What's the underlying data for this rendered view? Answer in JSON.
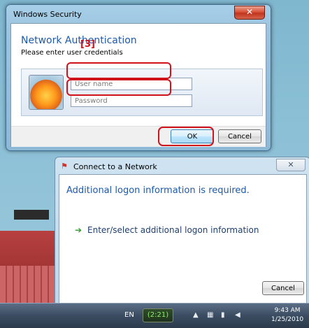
{
  "security_dialog": {
    "title": "Windows Security",
    "close": "✕",
    "heading": "Network Authentication",
    "subheading": "Please enter user credentials",
    "step_label": "[3]",
    "username_placeholder": "User name",
    "password_placeholder": "Password",
    "ok": "OK",
    "cancel": "Cancel"
  },
  "network_dialog": {
    "title": "Connect to a Network",
    "close": "✕",
    "heading": "Additional logon information is required.",
    "link": "Enter/select additional logon information",
    "link_icon": "➔",
    "cancel": "Cancel"
  },
  "taskbar": {
    "language": "EN",
    "battery": "(2:21)",
    "time": "9:43 AM",
    "date": "1/25/2010",
    "tray_icons": [
      "show-hidden-icon",
      "network-icon",
      "battery-icon",
      "volume-icon"
    ]
  },
  "colors": {
    "highlight": "#d0121b",
    "heading": "#1e5aa8",
    "ok_border": "#3c7fb1"
  }
}
